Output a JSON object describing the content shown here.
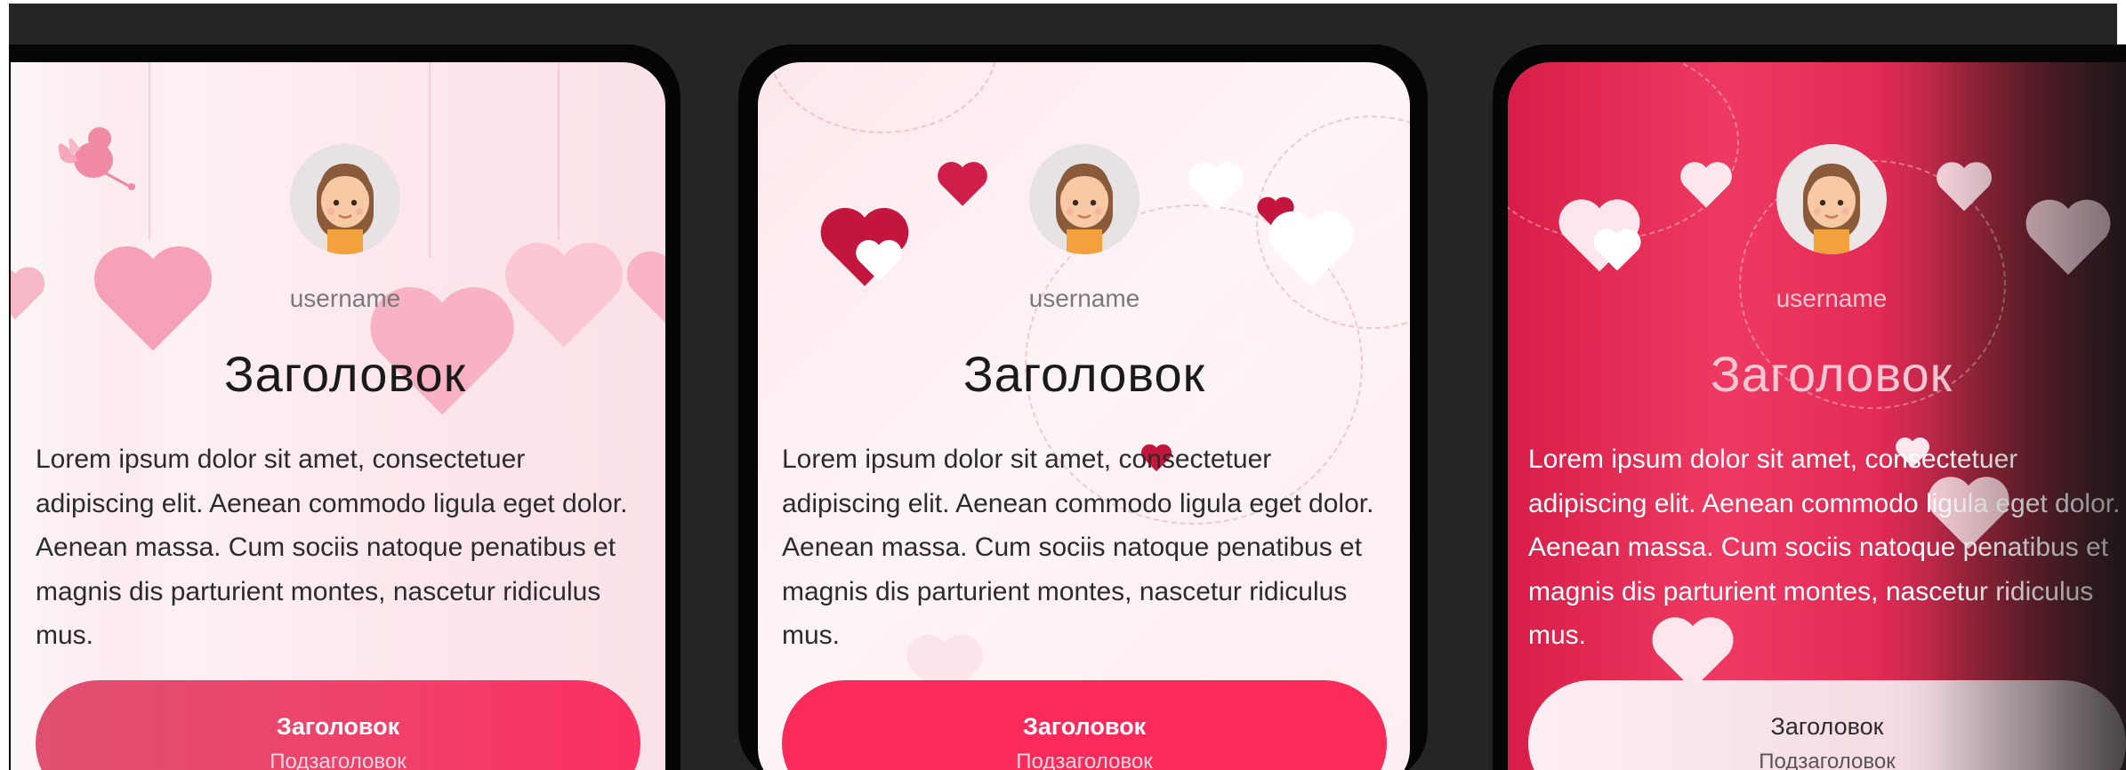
{
  "cards": [
    {
      "variant": "light-hanging-hearts",
      "username": "username",
      "title": "Заголовок",
      "body": "Lorem ipsum dolor sit amet, consectetuer adipiscing elit. Aenean commodo ligula eget dolor. Aenean massa. Cum sociis natoque penatibus et magnis dis parturient montes, nascetur ridiculus mus.",
      "button_title": "Заголовок",
      "button_subtitle": "Подзаголовок"
    },
    {
      "variant": "light-scattered-hearts",
      "username": "username",
      "title": "Заголовок",
      "body": "Lorem ipsum dolor sit amet, consectetuer adipiscing elit. Aenean commodo ligula eget dolor. Aenean massa. Cum sociis natoque penatibus et magnis dis parturient montes, nascetur ridiculus mus.",
      "button_title": "Заголовок",
      "button_subtitle": "Подзаголовок"
    },
    {
      "variant": "red-white-hearts",
      "username": "username",
      "title": "Заголовок",
      "body": "Lorem ipsum dolor sit amet, consectetuer adipiscing elit. Aenean commodo ligula eget dolor. Aenean massa. Cum sociis natoque penatibus et magnis dis parturient montes, nascetur ridiculus mus.",
      "button_title": "Заголовок",
      "button_subtitle": "Подзаголовок"
    }
  ],
  "icons": {
    "avatar": "girl-avatar-icon",
    "decor_heart": "heart-icon",
    "decor_cupid": "cupid-icon"
  },
  "colors": {
    "background": "#262524",
    "accent": "#fa2b5b",
    "card_light": "#fdeef1",
    "card_red": "#e22b55",
    "text_dark": "#2b2b2b",
    "username_gray": "#7a7a7a"
  }
}
